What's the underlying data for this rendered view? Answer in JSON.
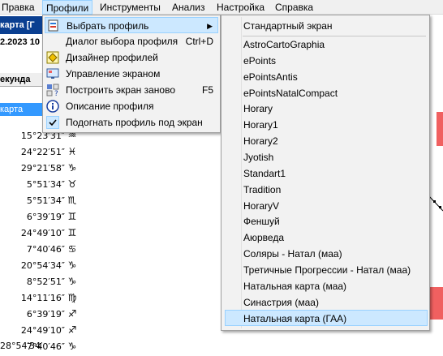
{
  "menubar": {
    "items": [
      "Правка",
      "Профили",
      "Инструменты",
      "Анализ",
      "Настройка",
      "Справка"
    ],
    "active_index": 1
  },
  "background": {
    "title_fragment": "карта [Г",
    "date_fragment": "2.2023 10",
    "column_header": "екунда",
    "selected_row": "карта",
    "positions": [
      {
        "deg": "15°23′31″",
        "glyph": "♒"
      },
      {
        "deg": "24°22′51″",
        "glyph": "♓"
      },
      {
        "deg": "29°21′58″",
        "glyph": "♑"
      },
      {
        "deg": "5°51′34″",
        "glyph": "♉"
      },
      {
        "deg": "5°51′34″",
        "glyph": "♏"
      },
      {
        "deg": "6°39′19″",
        "glyph": "♊"
      },
      {
        "deg": "24°49′10″",
        "glyph": "♊"
      },
      {
        "deg": "7°40′46″",
        "glyph": "♋"
      },
      {
        "deg": "20°54′34″",
        "glyph": "♑"
      },
      {
        "deg": "8°52′51″",
        "glyph": "♑"
      },
      {
        "deg": "14°11′16″",
        "glyph": "♍"
      },
      {
        "deg": "6°39′19″",
        "glyph": "♐"
      },
      {
        "deg": "24°49′10″",
        "glyph": "♐"
      },
      {
        "deg": "7°40′46″",
        "glyph": "♑"
      }
    ],
    "bottom_fragment": "28°54′34″"
  },
  "profiles_menu": {
    "items": [
      {
        "label": "Выбрать профиль",
        "shortcut": "",
        "icon": "profile-select-icon",
        "submenu": true,
        "highlighted": true
      },
      {
        "label": "Диалог выбора профиля",
        "shortcut": "Ctrl+D",
        "icon": "",
        "submenu": false,
        "highlighted": false
      },
      {
        "label": "Дизайнер профилей",
        "shortcut": "",
        "icon": "designer-icon",
        "submenu": false,
        "highlighted": false
      },
      {
        "label": "Управление экраном",
        "shortcut": "",
        "icon": "screen-manage-icon",
        "submenu": false,
        "highlighted": false
      },
      {
        "label": "Построить экран заново",
        "shortcut": "F5",
        "icon": "rebuild-icon",
        "submenu": false,
        "highlighted": false
      },
      {
        "label": "Описание профиля",
        "shortcut": "",
        "icon": "info-icon",
        "submenu": false,
        "highlighted": false
      },
      {
        "label": "Подогнать профиль под экран",
        "shortcut": "",
        "icon": "check-icon",
        "submenu": false,
        "highlighted": false
      }
    ]
  },
  "profile_submenu": {
    "standard": "Стандартный экран",
    "items": [
      "AstroCartoGraphia",
      "ePoints",
      "ePointsAntis",
      "ePointsNatalCompact",
      "Horary",
      "Horary1",
      "Horary2",
      "Jyotish",
      "Standart1",
      "Tradition",
      "HoraryV",
      "Феншуй",
      "Аюрведа",
      "Соляры - Натал (маа)",
      "Третичные Прогрессии - Натал (маа)",
      "Натальная карта (маа)",
      "Синастрия (маа)",
      "Натальная карта (ГАА)"
    ],
    "highlighted_index": 17
  },
  "colors": {
    "menu_highlight": "#cce8ff",
    "title_blue": "#0a3f91",
    "selection_blue": "#3399ff",
    "accent_red": "#f06060"
  }
}
